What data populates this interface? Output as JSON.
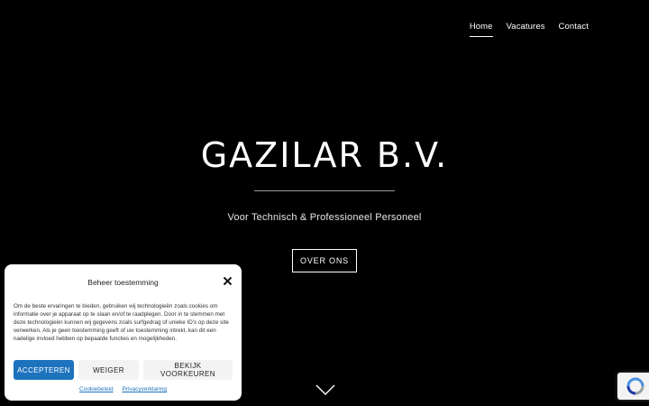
{
  "nav": {
    "items": [
      {
        "label": "Home",
        "active": true
      },
      {
        "label": "Vacatures",
        "active": false
      },
      {
        "label": "Contact",
        "active": false
      }
    ]
  },
  "hero": {
    "title": "GAZILAR B.V.",
    "subtitle": "Voor Technisch & Professioneel Personeel",
    "button_label": "OVER ONS",
    "scroll_icon": "chevron-down-icon"
  },
  "consent": {
    "title": "Beheer toestemming",
    "close_icon": "close-icon",
    "body": "Om de beste ervaringen te bieden, gebruiken wij technologieën zoals cookies om informatie over je apparaat op te slaan en/of te raadplegen. Door in te stemmen met deze technologieën kunnen wij gegevens zoals surfgedrag of unieke ID's op deze site verwerken. Als je geen toestemming geeft of uw toestemming intrekt, kan dit een nadelige invloed hebben op bepaalde functies en mogelijkheden.",
    "accept_label": "ACCEPTEREN",
    "deny_label": "WEIGER",
    "prefs_label": "BEKIJK VOORKEUREN",
    "links": [
      "Cookiebeleid",
      "Privacyverklaring"
    ]
  },
  "colors": {
    "background": "#000000",
    "accent": "#1e73be"
  },
  "recaptcha_icon": "recaptcha-icon"
}
